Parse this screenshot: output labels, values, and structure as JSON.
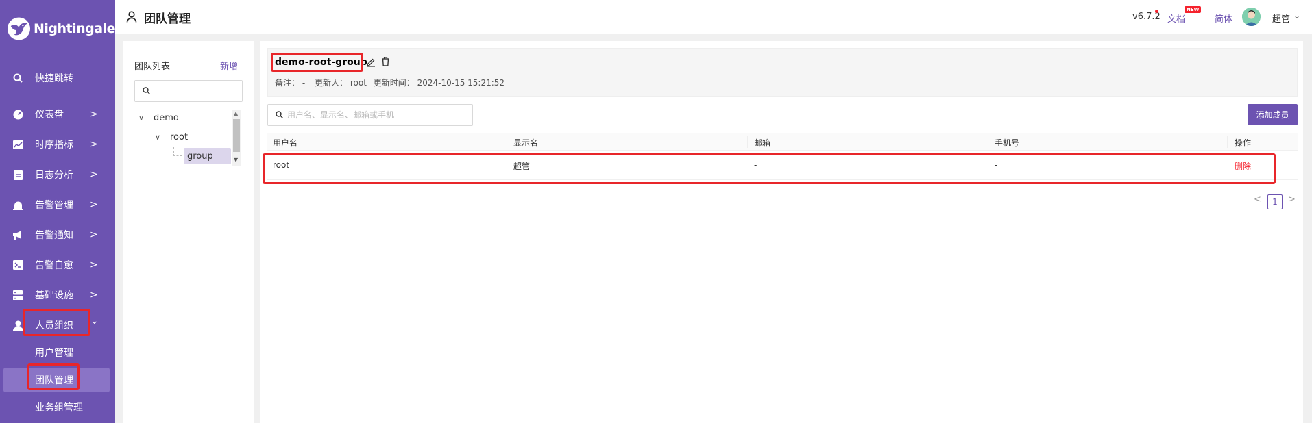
{
  "brand": {
    "name": "Nightingale"
  },
  "sidebar": {
    "items": [
      {
        "label": "快捷跳转",
        "icon": "search-icon"
      },
      {
        "label": "仪表盘",
        "icon": "dashboard-icon",
        "arrow": ">"
      },
      {
        "label": "时序指标",
        "icon": "line-chart-icon",
        "arrow": ">"
      },
      {
        "label": "日志分析",
        "icon": "log-icon",
        "arrow": ">"
      },
      {
        "label": "告警管理",
        "icon": "alarm-icon",
        "arrow": ">"
      },
      {
        "label": "告警通知",
        "icon": "megaphone-icon",
        "arrow": ">"
      },
      {
        "label": "告警自愈",
        "icon": "terminal-icon",
        "arrow": ">"
      },
      {
        "label": "基础设施",
        "icon": "server-icon",
        "arrow": ">"
      },
      {
        "label": "人员组织",
        "icon": "user-icon",
        "arrow": "⌄"
      }
    ],
    "sub_items": [
      {
        "label": "用户管理"
      },
      {
        "label": "团队管理",
        "active": true
      },
      {
        "label": "业务组管理"
      }
    ]
  },
  "header": {
    "title": "团队管理",
    "version": "v6.7.2",
    "docs": "文档",
    "new_badge": "NEW",
    "lang": "简体",
    "username": "超管"
  },
  "team_list": {
    "title": "团队列表",
    "new_label": "新增",
    "tree": [
      {
        "label": "demo",
        "level": 0
      },
      {
        "label": "root",
        "level": 1
      },
      {
        "label": "group",
        "level": 2,
        "selected": true
      }
    ]
  },
  "group": {
    "name": "demo-root-group",
    "note_label": "备注：",
    "note_value": "-",
    "updated_by_label": "更新人：",
    "updated_by": "root",
    "updated_at_label": "更新时间：",
    "updated_at": "2024-10-15 15:21:52"
  },
  "members": {
    "search_placeholder": "用户名、显示名、邮箱或手机",
    "add_label": "添加成员",
    "columns": [
      "用户名",
      "显示名",
      "邮箱",
      "手机号",
      "操作"
    ],
    "rows": [
      {
        "username": "root",
        "display_name": "超管",
        "email": "-",
        "phone": "-",
        "action": "删除"
      }
    ]
  },
  "pagination": {
    "prev": "<",
    "current": "1",
    "next": ">"
  },
  "colors": {
    "sidebar": "#6c53b1",
    "accent": "#6c53b1",
    "danger": "#f5222d",
    "highlight": "#e8262a"
  }
}
